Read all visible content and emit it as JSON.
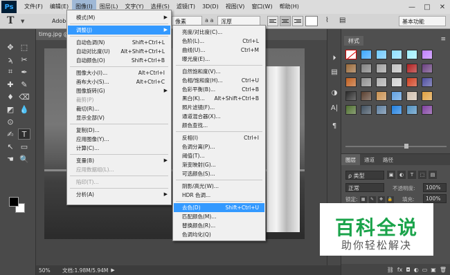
{
  "app": {
    "logo": "Ps",
    "menu": [
      "文件(F)",
      "编辑(E)",
      "图像(I)",
      "图层(L)",
      "文字(Y)",
      "选择(S)",
      "滤镜(T)",
      "3D(D)",
      "视图(V)",
      "窗口(W)",
      "帮助(H)"
    ],
    "active_menu_index": 2,
    "window_controls": {
      "minimize": "—",
      "maximize": "□",
      "close": "✕"
    }
  },
  "options_bar": {
    "tool_glyph": "T",
    "font_family": "Adobe",
    "font_unit": "像素",
    "aa_icon": "a a",
    "aa_mode": "浑厚",
    "workspace": "基本功能"
  },
  "document": {
    "tab_title": "timg.jpg @"
  },
  "status": {
    "zoom": "50%",
    "doc_info": "文档:1.98M/5.94M",
    "arrow": "▶"
  },
  "swatches": {
    "tab_label": "样式",
    "menu_icon": "≡",
    "colors": [
      "nocolor",
      "#3ba7ff",
      "#6fc9ff",
      "#8fdfff",
      "#a0f0ff",
      "#c080ff",
      "#9a6a3a",
      "#808080",
      "#a0a0a0",
      "#c0c0c0",
      "#b02020",
      "#6a4080",
      "#c06020",
      "#909090",
      "#b0b0b0",
      "#d0d0d0",
      "#d04020",
      "#5050a0",
      "#2a2a2a",
      "#5a4030",
      "#c89050",
      "#60a0e0",
      "#d0c0b0",
      "#e0a040",
      "#507030",
      "#405060",
      "#6080a0",
      "#2080e0",
      "#5090c0",
      "#8040a0"
    ]
  },
  "layers": {
    "tabs": [
      "图层",
      "通道",
      "路径"
    ],
    "filter_label": "ρ 类型",
    "filter_icons": [
      "▣",
      "◐",
      "T",
      "⬚",
      "▤"
    ],
    "blend_mode": "正常",
    "opacity_label": "不透明度:",
    "opacity_value": "100%",
    "lock_label": "锁定:",
    "lock_icons": [
      "▦",
      "✎",
      "✥",
      "🔒"
    ],
    "fill_label": "填充:",
    "fill_value": "100%",
    "footer_icons": [
      "⛓",
      "fx",
      "◘",
      "◐",
      "▭",
      "▣",
      "🗑"
    ]
  },
  "image_menu": {
    "items": [
      {
        "label": "模式(M)",
        "shortcut": "",
        "submenu": true,
        "disabled": false,
        "highlighted": false
      },
      {
        "sep": true
      },
      {
        "label": "调整(J)",
        "shortcut": "",
        "submenu": true,
        "disabled": false,
        "highlighted": true
      },
      {
        "sep": true
      },
      {
        "label": "自动色调(N)",
        "shortcut": "Shift+Ctrl+L",
        "submenu": false,
        "disabled": false,
        "highlighted": false
      },
      {
        "label": "自动对比度(U)",
        "shortcut": "Alt+Shift+Ctrl+L",
        "submenu": false,
        "disabled": false,
        "highlighted": false
      },
      {
        "label": "自动颜色(O)",
        "shortcut": "Shift+Ctrl+B",
        "submenu": false,
        "disabled": false,
        "highlighted": false
      },
      {
        "sep": true
      },
      {
        "label": "图像大小(I)...",
        "shortcut": "Alt+Ctrl+I",
        "submenu": false,
        "disabled": false,
        "highlighted": false
      },
      {
        "label": "画布大小(S)...",
        "shortcut": "Alt+Ctrl+C",
        "submenu": false,
        "disabled": false,
        "highlighted": false
      },
      {
        "label": "图像旋转(G)",
        "shortcut": "",
        "submenu": true,
        "disabled": false,
        "highlighted": false
      },
      {
        "label": "裁剪(P)",
        "shortcut": "",
        "submenu": false,
        "disabled": true,
        "highlighted": false
      },
      {
        "label": "裁切(R)...",
        "shortcut": "",
        "submenu": false,
        "disabled": false,
        "highlighted": false
      },
      {
        "label": "显示全部(V)",
        "shortcut": "",
        "submenu": false,
        "disabled": false,
        "highlighted": false
      },
      {
        "sep": true
      },
      {
        "label": "复制(D)...",
        "shortcut": "",
        "submenu": false,
        "disabled": false,
        "highlighted": false
      },
      {
        "label": "应用图像(Y)...",
        "shortcut": "",
        "submenu": false,
        "disabled": false,
        "highlighted": false
      },
      {
        "label": "计算(C)...",
        "shortcut": "",
        "submenu": false,
        "disabled": false,
        "highlighted": false
      },
      {
        "sep": true
      },
      {
        "label": "变量(B)",
        "shortcut": "",
        "submenu": true,
        "disabled": false,
        "highlighted": false
      },
      {
        "label": "应用数据组(L)...",
        "shortcut": "",
        "submenu": false,
        "disabled": true,
        "highlighted": false
      },
      {
        "sep": true
      },
      {
        "label": "陷印(T)...",
        "shortcut": "",
        "submenu": false,
        "disabled": true,
        "highlighted": false
      },
      {
        "sep": true
      },
      {
        "label": "分析(A)",
        "shortcut": "",
        "submenu": true,
        "disabled": false,
        "highlighted": false
      }
    ]
  },
  "adjust_menu": {
    "items": [
      {
        "label": "亮度/对比度(C)...",
        "shortcut": "",
        "highlighted": false
      },
      {
        "label": "色阶(L)...",
        "shortcut": "Ctrl+L",
        "highlighted": false
      },
      {
        "label": "曲线(U)...",
        "shortcut": "Ctrl+M",
        "highlighted": false
      },
      {
        "label": "曝光度(E)...",
        "shortcut": "",
        "highlighted": false
      },
      {
        "sep": true
      },
      {
        "label": "自然饱和度(V)...",
        "shortcut": "",
        "highlighted": false
      },
      {
        "label": "色相/饱和度(H)...",
        "shortcut": "Ctrl+U",
        "highlighted": false
      },
      {
        "label": "色彩平衡(B)...",
        "shortcut": "Ctrl+B",
        "highlighted": false
      },
      {
        "label": "黑白(K)...",
        "shortcut": "Alt+Shift+Ctrl+B",
        "highlighted": false
      },
      {
        "label": "照片滤镜(F)...",
        "shortcut": "",
        "highlighted": false
      },
      {
        "label": "通道混合器(X)...",
        "shortcut": "",
        "highlighted": false
      },
      {
        "label": "颜色查找...",
        "shortcut": "",
        "highlighted": false
      },
      {
        "sep": true
      },
      {
        "label": "反相(I)",
        "shortcut": "Ctrl+I",
        "highlighted": false
      },
      {
        "label": "色调分离(P)...",
        "shortcut": "",
        "highlighted": false
      },
      {
        "label": "阈值(T)...",
        "shortcut": "",
        "highlighted": false
      },
      {
        "label": "渐变映射(G)...",
        "shortcut": "",
        "highlighted": false
      },
      {
        "label": "可选颜色(S)...",
        "shortcut": "",
        "highlighted": false
      },
      {
        "sep": true
      },
      {
        "label": "阴影/高光(W)...",
        "shortcut": "",
        "highlighted": false
      },
      {
        "label": "HDR 色调...",
        "shortcut": "",
        "highlighted": false
      },
      {
        "sep": true
      },
      {
        "label": "去色(D)",
        "shortcut": "Shift+Ctrl+U",
        "highlighted": true
      },
      {
        "label": "匹配颜色(M)...",
        "shortcut": "",
        "highlighted": false
      },
      {
        "label": "替换颜色(R)...",
        "shortcut": "",
        "highlighted": false
      },
      {
        "label": "色调均化(Q)",
        "shortcut": "",
        "highlighted": false
      }
    ]
  },
  "watermark": {
    "title": "百科全说",
    "subtitle": "助你轻松解决"
  },
  "tools": {
    "glyphs": [
      "✥",
      "⬚",
      "ϡ",
      "✂",
      "⌗",
      "✒",
      "✚",
      "✎",
      "♦",
      "⌫",
      "◩",
      "💧",
      "⊙",
      "✍",
      "T",
      "↖",
      "▭",
      "☚",
      "🔍"
    ]
  },
  "right_strip_icons": [
    "⏵",
    "▤",
    "◑",
    "A|",
    "¶"
  ],
  "accent": {
    "menu_highlight": "#3399ff",
    "watermark_green": "#1aa34a"
  }
}
